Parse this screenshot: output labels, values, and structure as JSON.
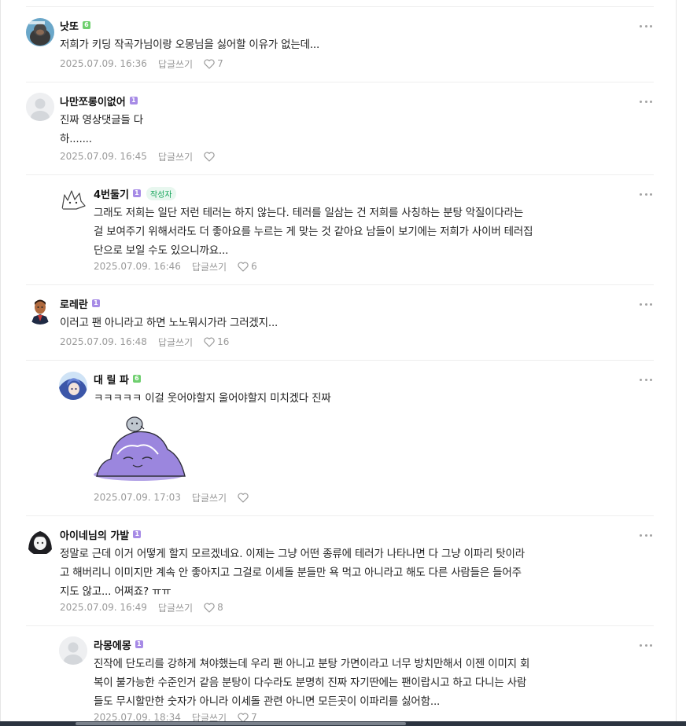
{
  "colors": {
    "level_green": "#6fcf6f",
    "level_purple": "#a78be6",
    "author_badge": "#17a55b",
    "meta_text": "#9a9a9a"
  },
  "icons": {
    "more": "more-horizontal-icon",
    "like": "heart-outline-icon"
  },
  "comments": [
    {
      "nickname": "낫또",
      "level_color": "green",
      "lines": [
        "저희가 키딩 작곡가님이랑 오몽님을 싫어할 이유가 없는데..."
      ],
      "date": "2025.07.09. 16:36",
      "reply_label": "답글쓰기",
      "likes": "7"
    },
    {
      "nickname": "나만쪼롱이없어",
      "level_color": "purple",
      "lines": [
        "진짜 영상댓글들 다",
        "하......."
      ],
      "date": "2025.07.09. 16:45",
      "reply_label": "답글쓰기",
      "likes": ""
    },
    {
      "nickname": "4번둘기",
      "level_color": "purple",
      "author_badge": "작성자",
      "lines": [
        "그래도 저희는 일단 저런 테러는 하지 않는다. 테러를 일삼는 건 저희를 사칭하는 분탕 악질이다라는",
        "걸 보여주기 위해서라도 더 좋아요를 누르는 게 맞는 것 같아요 남들이 보기에는 저희가 사이버 테러집",
        "단으로 보일 수도 있으니까요..."
      ],
      "date": "2025.07.09. 16:46",
      "reply_label": "답글쓰기",
      "likes": "6"
    },
    {
      "nickname": "로레란",
      "level_color": "purple",
      "lines": [
        "이러고 팬 아니라고 하면 노노뭐시가라 그러겠지..."
      ],
      "date": "2025.07.09. 16:48",
      "reply_label": "답글쓰기",
      "likes": "16"
    },
    {
      "nickname": "대 릴 파",
      "level_color": "green",
      "lines": [
        "ㅋㅋㅋㅋㅋ 이걸 웃어야할지 울어야할지 미치겠다 진짜"
      ],
      "date": "2025.07.09. 17:03",
      "reply_label": "답글쓰기",
      "likes": ""
    },
    {
      "nickname": "아이네님의 가발",
      "level_color": "purple",
      "lines": [
        "정말로 근데 이거 어떻게 할지 모르겠네요. 이제는 그냥 어떤 종류에 테러가 나타나면 다 그냥 이파리 탓이라",
        "고 해버리니 이미지만 계속 안 좋아지고 그걸로 이세돌 분들만 욕 먹고 아니라고 해도 다른 사람들은 들어주",
        "지도 않고... 어쩌죠? ㅠㅠ"
      ],
      "date": "2025.07.09. 16:49",
      "reply_label": "답글쓰기",
      "likes": "8"
    },
    {
      "nickname": "라몽에몽",
      "level_color": "purple",
      "lines": [
        "진작에 단도리를 강하게 쳐야했는데 우리 팬 아니고 분탕 가면이라고 너무 방치만해서 이젠 이미지 회",
        "복이 불가능한 수준인거 같음 분탕이 다수라도 분명히 진짜 자기딴에는 팬이랍시고 하고 다니는 사람",
        "들도 무시할만한 숫자가 아니라 이세돌 관련 아니면 모든곳이 이파리를 싫어함..."
      ],
      "date": "2025.07.09. 18:34",
      "reply_label": "답글쓰기",
      "likes": "7"
    }
  ]
}
